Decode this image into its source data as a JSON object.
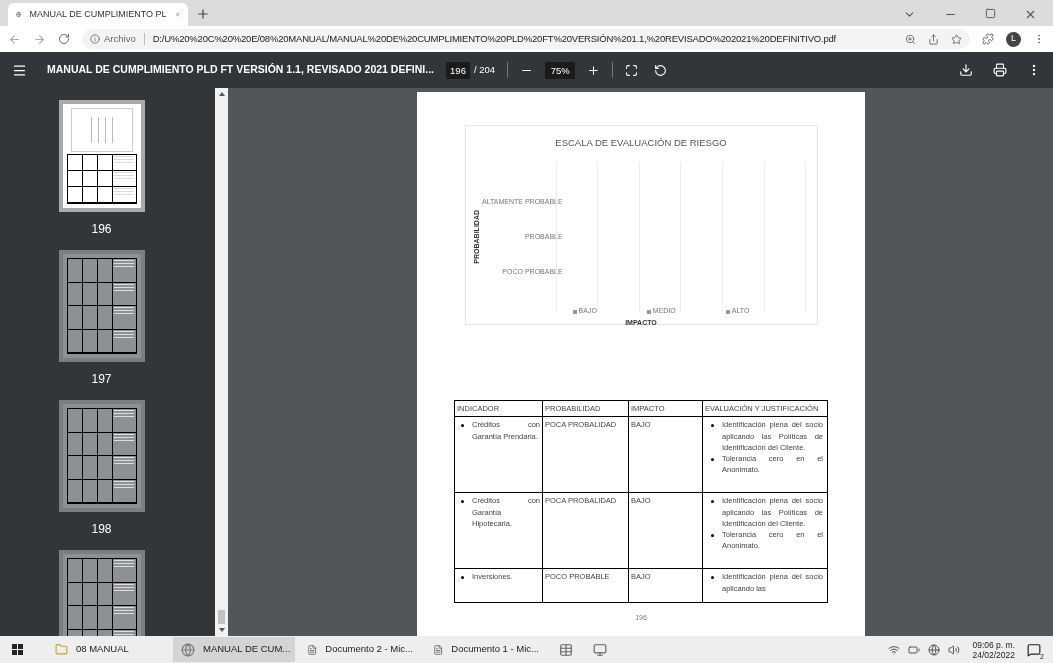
{
  "browser": {
    "tabs": [
      {
        "title": "MANUAL DE CUMPLIMIENTO PL",
        "selected": true
      }
    ],
    "address_label": "Archivo",
    "url": "D:/U%20%20C%20%20E/08%20MANUAL/MANUAL%20DE%20CUMPLIMIENTO%20PLD%20FT%20VERSIÓN%201.1,%20REVISADO%202021%20DEFINITIVO.pdf",
    "profile_initial": "L"
  },
  "pdf_toolbar": {
    "title": "MANUAL DE CUMPLIMIENTO PLD FT VERSIÓN 1.1, REVISADO 2021 DEFINI...",
    "page": "196",
    "page_total": "/ 204",
    "zoom": "75%"
  },
  "thumbnails": [
    {
      "label": "196",
      "selected": true
    },
    {
      "label": "197",
      "selected": false
    },
    {
      "label": "198",
      "selected": false
    },
    {
      "selected": false
    }
  ],
  "page": {
    "chart": {
      "title": "ESCALA DE EVALUACIÓN DE RIESGO",
      "ylabel": "PROBABILIDAD",
      "y_categories": [
        "ALTAMENTE PROBABLE",
        "PROBABLE",
        "POCO PROBABLE"
      ],
      "xlabel": "IMPACTO",
      "legend": [
        "BAJO",
        "MEDIO",
        "ALTO"
      ]
    },
    "table": {
      "columns": [
        "INDICADOR",
        "PROBABILIDAD",
        "IMPACTO",
        "EVALUACIÓN Y JUSTIFICACIÓN"
      ],
      "rows": [
        {
          "indicator": "Créditos con Garantía Prendaria.",
          "probability": "POCA PROBALIDAD",
          "impact": "BAJO",
          "evaluation": [
            "Identificación plena del socio aplicando las Políticas de Identificación del Cliente.",
            "Tolerancia cero en el Anonimato."
          ]
        },
        {
          "indicator": "Créditos con Garantía Hipotecaria.",
          "probability": "POCA PROBALIDAD",
          "impact": "BAJO",
          "evaluation": [
            "Identificación plena del socio aplicando las Políticas de Identificación del Cliente.",
            "Tolerancia cero en el Anonimato."
          ]
        },
        {
          "indicator": "Inversiones.",
          "probability": "POCO PROBABLE",
          "impact": "BAJO",
          "evaluation": [
            "Identificación plena del socio aplicando las"
          ]
        }
      ]
    },
    "page_number": "196"
  },
  "taskbar": {
    "items": [
      {
        "kind": "folder",
        "label": "08 MANUAL",
        "selected": false
      },
      {
        "kind": "browser",
        "label": "MANUAL DE CUM...",
        "selected": true
      },
      {
        "kind": "document",
        "label": "Documento 2 - Mic...",
        "selected": false
      },
      {
        "kind": "document",
        "label": "Documento 1 - Mic...",
        "selected": false
      },
      {
        "kind": "sheet",
        "selected": false
      },
      {
        "kind": "app",
        "selected": false
      }
    ],
    "time": "09:06 p. m.",
    "date": "24/02/2022",
    "notifications": "2"
  }
}
